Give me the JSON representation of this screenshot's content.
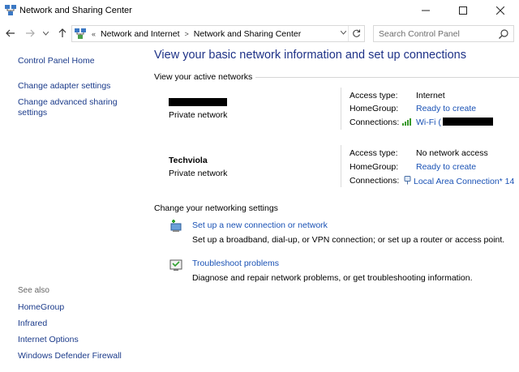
{
  "window": {
    "title": "Network and Sharing Center",
    "icons": {
      "app": "network-sharing-center-icon",
      "minimize": "minimize-icon",
      "maximize": "maximize-icon",
      "close": "close-icon"
    }
  },
  "nav": {
    "breadcrumbs": [
      "Network and Internet",
      "Network and Sharing Center"
    ],
    "overflow": "«",
    "search_placeholder": "Search Control Panel"
  },
  "sidebar": {
    "links": [
      "Control Panel Home",
      "Change adapter settings",
      "Change advanced sharing settings"
    ],
    "see_also_heading": "See also",
    "see_also": [
      "HomeGroup",
      "Infrared",
      "Internet Options",
      "Windows Defender Firewall"
    ]
  },
  "main": {
    "title": "View your basic network information and set up connections",
    "active_networks_heading": "View your active networks",
    "networks": [
      {
        "name": "",
        "name_redacted": true,
        "type": "Private network",
        "access_label": "Access type:",
        "access_value": "Internet",
        "homegroup_label": "HomeGroup:",
        "homegroup_value": "Ready to create",
        "connections_label": "Connections:",
        "connection_value": "Wi-Fi (",
        "connection_icon": "wifi-signal-icon"
      },
      {
        "name": "Techviola",
        "name_redacted": false,
        "type": "Private network",
        "access_label": "Access type:",
        "access_value": "No network access",
        "homegroup_label": "HomeGroup:",
        "homegroup_value": "Ready to create",
        "connections_label": "Connections:",
        "connection_value": "Local Area Connection* 14",
        "connection_icon": "ethernet-adapter-icon"
      }
    ],
    "change_settings_heading": "Change your networking settings",
    "tasks": [
      {
        "link": "Set up a new connection or network",
        "desc": "Set up a broadband, dial-up, or VPN connection; or set up a router or access point."
      },
      {
        "link": "Troubleshoot problems",
        "desc": "Diagnose and repair network problems, or get troubleshooting information."
      }
    ]
  },
  "colors": {
    "link": "#1a52b5",
    "title": "#1e3287",
    "sidebar_link": "#1a3a8a",
    "signal": "#3a9a2a"
  }
}
